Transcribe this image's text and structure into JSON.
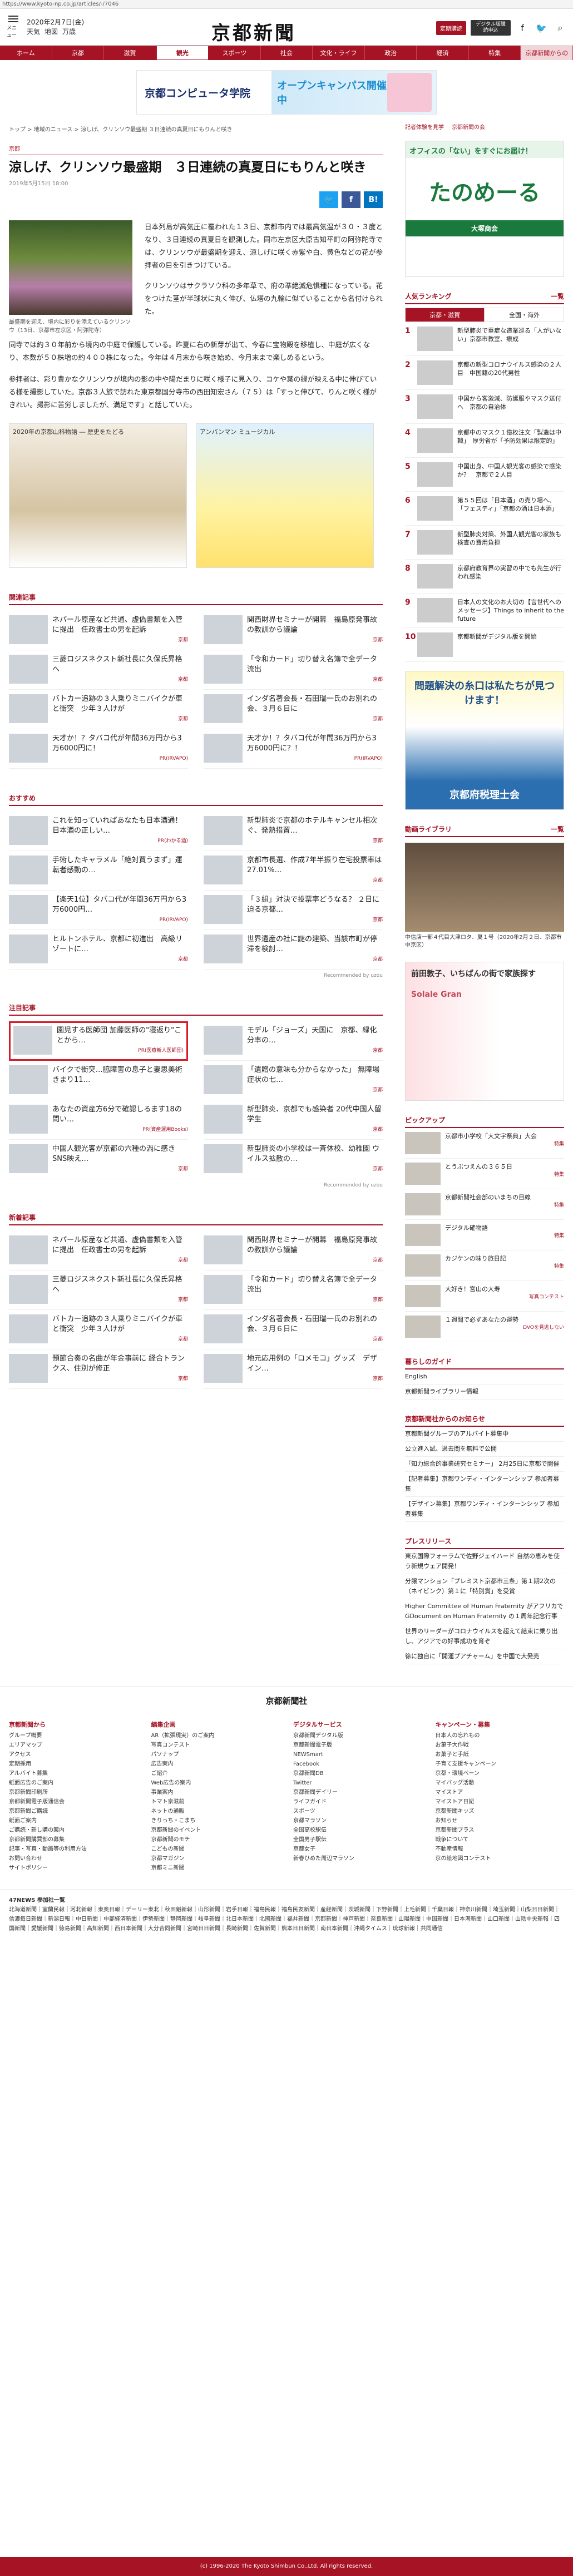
{
  "url": "https://www.kyoto-np.co.jp/articles/-/7046",
  "header": {
    "menu_label": "メニュー",
    "date": "2020年2月7日(金)",
    "links": [
      "天気",
      "地図",
      "万歳"
    ],
    "logo": "京都新聞",
    "btn_red": "定期購読",
    "btn_dark": "デジタル版購読申込",
    "icons": [
      "facebook-icon",
      "twitter-icon",
      "search-icon"
    ]
  },
  "nav": {
    "items": [
      "ホーム",
      "京都",
      "滋賀",
      "観光",
      "スポーツ",
      "社会",
      "文化・ライフ",
      "政治",
      "経済",
      "特集",
      "京都新聞からの"
    ],
    "active_index": 3
  },
  "top_ad": {
    "left": "京都コンピュータ学院",
    "right": "オープンキャンパス開催中"
  },
  "breadcrumb": "トップ > 地域のニュース > 涼しげ、クリンソウ最盛期 ３日連続の真夏日にもりんと咲き",
  "category": "京都",
  "article": {
    "title": "涼しげ、クリンソウ最盛期　３日連続の真夏日にもりんと咲き",
    "date": "2019年5月15日 18:00",
    "share": [
      "Twitter",
      "f",
      "B!"
    ],
    "photo_caption": "最盛期を迎え、境内に彩りを添えているクリンソウ（13日、京都市左京区・阿弥陀寺）",
    "paras_side": [
      "日本列島が高気圧に覆われた１３日、京都市内では最高気温が３０・３度となり、３日連続の真夏日を観測した。同市左京区大原古知平町の阿弥陀寺では、クリンソウが最盛期を迎え、涼しげに咲く赤紫や白、黄色などの花が参拝者の目を引きつけている。",
      "クリンソウはサクラソウ科の多年草で、府の準絶滅危惧種になっている。花をつけた茎が半球状に丸く伸び、仏塔の九輪に似ていることから名付けられた。"
    ],
    "paras_full": [
      "同寺では約３０年前から境内の中庭で保護している。昨夏に右の新芽が出て、今春に宝物殿を移植し、中庭が広くなり、本数が５０株増の約４００株になった。今年は４月末から咲き始め、今月末まで楽しめるという。",
      "参拝者は、彩り豊かなクリンソウが境内の影の中や陽だまりに咲く様子に見入り、コケや葉の緑が映える中に伸びている様を撮影していた。京都３人旅で訪れた東京都国分寺市の西田知宏さん（７５）は「すっと伸びて、りんと咲く様がきれい。撮影に苦労しましたが、満足です」と話していた。"
    ]
  },
  "mid_ads": [
    {
      "label": "2020年の京都山科物語 ― 歴史をたどる"
    },
    {
      "label": "アンパンマン ミュージカル"
    }
  ],
  "related": {
    "heading": "関連記事",
    "items": [
      {
        "text": "ネパール原産など共通、虚偽書類を入管に提出　任政書士の男を起訴",
        "loc": "京都"
      },
      {
        "text": "関西財界セミナーが開幕　福島原発事故の教訓から議論",
        "loc": "京都"
      },
      {
        "text": "三菱ロジスネクスト新社長に久保氏昇格へ",
        "loc": "京都"
      },
      {
        "text": "「令和カード」切り替え名簿で全データ流出",
        "loc": "京都"
      },
      {
        "text": "バトカー追跡の３人乗りミニバイクが車と衝突　少年３人けが",
        "loc": "京都"
      },
      {
        "text": "インダ名著会長・石田瑞一氏のお別れの会、３月６日に",
        "loc": "京都"
      },
      {
        "text": "天才か！？タバコ代が年間36万円から3万6000円に！",
        "loc": "PR(IRVAPO)"
      },
      {
        "text": "天才か！？タバコ代が年間36万円から3万6000円に？！",
        "loc": "PR(IRVAPO)"
      }
    ]
  },
  "osusume": {
    "heading": "おすすめ",
    "items": [
      {
        "text": "これを知っていればあなたも日本酒通！日本酒の正しい…",
        "loc": "PR(わかる酒)"
      },
      {
        "text": "新型肺炎で京都のホテルキャンセル相次ぐ、発熱措置…",
        "loc": "京都"
      },
      {
        "text": "手術したキャラメル「絶対買うまず」運転者感動の…",
        "loc": ""
      },
      {
        "text": "京都市長選、作成7年半振り在宅投票率は27.01%…",
        "loc": "京都"
      },
      {
        "text": "【楽天1位】タバコ代が年間36万円から3万6000円…",
        "loc": "PR(IRVAPO)"
      },
      {
        "text": "「３組」対決で投票率どうなる？ ２日に迫る京都…",
        "loc": "京都"
      },
      {
        "text": "ヒルトンホテル、京都に初進出　高級リゾートに…",
        "loc": "京都"
      },
      {
        "text": "世界遺産の社に謎の建築、当該市町が停滞を検討…",
        "loc": "京都"
      }
    ],
    "recommended": "Recommended by uzou"
  },
  "chumoku": {
    "heading": "注目記事",
    "items": [
      {
        "text": "園児する医師団 加藤医師の\"寝返り\"ことから…",
        "loc": "PR(医療新人医師団)",
        "highlight": true
      },
      {
        "text": "モデル「ジョーズ」天国に　京都、緑化分率の…",
        "loc": "京都"
      },
      {
        "text": "バイクで衝突…脇障害の息子と妻思美術きまり11…",
        "loc": ""
      },
      {
        "text": "「遺贈の意味も分からなかった」 無障場症状の七…",
        "loc": "京都"
      },
      {
        "text": "あなたの資産方6分で確認しるます18の問い…",
        "loc": "PR(資産運用Books)"
      },
      {
        "text": "新型肺炎、京都でも感染者 20代中国人留学生",
        "loc": "京都"
      },
      {
        "text": "中国人観光客が京都の六種の渦に感き SNS映え…",
        "loc": "京都"
      },
      {
        "text": "新型肺炎の小学校は一斉休校、幼稚園 ウイルス拡散の…",
        "loc": "京都"
      }
    ],
    "recommended": "Recommended by uzou"
  },
  "shinchaku": {
    "heading": "新着記事",
    "items": [
      {
        "text": "ネパール原産など共通、虚偽書類を入管に提出　任政書士の男を起訴",
        "loc": "京都"
      },
      {
        "text": "関西財界セミナーが開幕　福島原発事故の教訓から議論",
        "loc": "京都"
      },
      {
        "text": "三菱ロジスネクスト新社長に久保氏昇格へ",
        "loc": "京都"
      },
      {
        "text": "「令和カード」切り替え名簿で全データ流出",
        "loc": "京都"
      },
      {
        "text": "バトカー追跡の３人乗りミニバイクが車と衝突　少年３人けが",
        "loc": "京都"
      },
      {
        "text": "インダ名著会長・石田瑞一氏のお別れの会、３月６日に",
        "loc": "京都"
      },
      {
        "text": "預節合奏の名曲が年金事前に 経合トランクス、住別が修正",
        "loc": "京都"
      },
      {
        "text": "地元応用例の「ロメモコ」グッズ　デザイン…",
        "loc": "京都"
      }
    ]
  },
  "sidebar": {
    "top_links": [
      "記者体験を見学",
      "京都新聞の会"
    ],
    "ad1": {
      "top": "オフィスの「ない」をすぐにお届け！",
      "logo": "たのめーる",
      "bottom": "大塚商会"
    },
    "ranking": {
      "heading": "人気ランキング",
      "more": "一覧",
      "tabs": [
        "京都・滋賀",
        "全国・海外"
      ],
      "items": [
        "新型肺炎で重症な造業巡る「人がいない」京都市教室、療成",
        "京都の新型コロナウイルス感染の２人目　中国籍の20代男性",
        "中国から客激減、防護服やマスク送付へ　京都の自治体",
        "京都中のマスク１億枚注文「製造は中韓」　厚労省が「予防効果は限定的」",
        "中国出身、中国人観光客の感染で感染か？　京都で２人目",
        "第５５回は「日本酒」の売り場へ、「フェスティ」「京都の酒は日本酒」",
        "新型肺炎対策、外国人観光客の家族も検査の費用負担",
        "京都府教育界の実習の中でも先生が行われ感染",
        "日本人の文化のお大切の【言世代へのメッセージ】Things to inherit to the future",
        "京都新聞がデジタル版を開始"
      ]
    },
    "ad2": {
      "text": "問題解決の糸口は私たちが見つけます！",
      "bottom": "京都府税理士会"
    },
    "video": {
      "heading": "動画ライブラリ",
      "more": "一覧",
      "caption": "中信店一部４代目大津ロタ、夏１号（2020年2月２日、京都市中京区）"
    },
    "ad3": {
      "text": "前田敦子、いちばんの街で家族探す",
      "brand": "Solale Gran"
    },
    "pickup": {
      "heading": "ピックアップ",
      "items": [
        {
          "text": "京都市小学校「大文字祭典」大会",
          "loc": "特集"
        },
        {
          "text": "とうぶつえんの３６５日",
          "loc": "特集"
        },
        {
          "text": "京都新聞社会部のいまちの目線",
          "loc": "特集"
        },
        {
          "text": "デジタル確物語",
          "loc": "特集"
        },
        {
          "text": "カジケンの味り旅日記",
          "loc": "特集"
        },
        {
          "text": "大好き！宮山の大寿",
          "loc": "写真コンテスト"
        },
        {
          "text": "１週間で必ずあなたの運勢",
          "loc": "DVOを見逃しない"
        }
      ]
    },
    "guide": {
      "heading": "暮らしのガイド",
      "items": [
        "English",
        "京都新聞ライブラリー情報"
      ]
    },
    "notice": {
      "heading": "京都新聞社からのお知らせ",
      "items": [
        "京都新聞グループのアルバイト募集中",
        "公立進入試、過去問を無料で公開",
        "「知力総合的事業研究セミナー」 2月25日に京都で開催",
        "【記者募集】京都ワンディ・インターンシップ 参加者募集",
        "【デザイン募集】京都ワンディ・インターンシップ 参加者募集"
      ]
    },
    "press": {
      "heading": "プレスリリース",
      "items": [
        "東京国際フォーラムで佐野ジェイハード 自然の恵みを使う新規ウェア開発！",
        "分譲マンション「プレミスト京都市三条」第１期2次の（ネイビンク）第１に「特別賞」を受賞",
        "Higher Committee of Human Fraternity がアフリカでGDocument on Human Fraternity の１周年記念行事",
        "世界のリーダーがコロナウイルスを超えて結束に乗り出し、アジアでの好事成功を育ぞ",
        "徐に独自に「開運プアチャーム」を中国で大発売"
      ]
    }
  },
  "footer": {
    "logo": "京都新聞社",
    "cols": [
      {
        "title": "京都新聞から",
        "links": [
          "グループ概要",
          "エリアマップ",
          "アクセス",
          "定期採用",
          "アルバイト募集",
          "紙面広告のご案内",
          "京都新聞印刷所",
          "京都新聞電子版通信会",
          "京都新聞ご購読",
          "紙面ご案内",
          "ご購読・新し購の案内",
          "京都新聞購買部の募集",
          "記事・写真・動画等の利用方法",
          "お問い合わせ",
          "サイトポリシー"
        ]
      },
      {
        "title": "編集企画",
        "links": [
          "AR（拡張現実）のご案内",
          "写真コンテスト",
          "パソナップ",
          "広告案内",
          "ご紹介",
          "Web広告の案内",
          "事業案内",
          "トマト京滋前",
          "ネットの通販",
          "きりっち・こまち",
          "京都新聞のイベント",
          "京都新聞のモチ",
          "こどもの新聞",
          "京都マガジン",
          "京都ミニ新聞"
        ]
      },
      {
        "title": "デジタルサービス",
        "links": [
          "京都新聞デジタル版",
          "京都新聞電子版",
          "NEWSmart",
          "Facebook",
          "京都新聞DB",
          "Twitter",
          "京都新聞デイリー",
          "ライフガイド",
          "スポーツ",
          "京都マラソン",
          "全国高校駅伝",
          "全国男子駅伝",
          "京都女子",
          "新春ひめた周辺マラソン"
        ]
      },
      {
        "title": "キャンペーン・募集",
        "links": [
          "日本人の忘れもの",
          "お菓子大作戦",
          "お菓子と手紙",
          "子育て支援キャンペーン",
          "京都・環境ペーン",
          "マイバッグ活動",
          "マイストア",
          "マイストア日記",
          "京都新聞キッズ",
          "お知らせ",
          "京都新聞プラス",
          "戦争について",
          "不動産情報",
          "京の絵地図コンテスト"
        ]
      }
    ]
  },
  "fourty": {
    "title": "47NEWS 参加社一覧",
    "text": "北海道新聞｜室蘭民報｜河北新報｜東奥日報｜デーリー東北｜秋田魁新報｜山形新聞｜岩手日報｜福島民報｜福島民友新聞｜産経新聞｜茨城新聞｜下野新聞｜上毛新聞｜千葉日報｜神奈川新聞｜埼玉新聞｜山梨日日新聞｜信濃毎日新聞｜新潟日報｜中日新聞｜中部経済新聞｜伊勢新聞｜静岡新聞｜岐阜新聞｜北日本新聞｜北國新聞｜福井新聞｜京都新聞｜神戸新聞｜奈良新聞｜山陽新聞｜中国新聞｜日本海新聞｜山口新聞｜山陰中央新報｜四国新聞｜愛媛新聞｜徳島新聞｜高知新聞｜西日本新聞｜大分合同新聞｜宮崎日日新聞｜長崎新聞｜佐賀新聞｜熊本日日新聞｜南日本新聞｜沖縄タイムス｜琉球新報｜共同通信"
  },
  "copyright": "(c) 1996-2020 The Kyoto Shimbun Co.,Ltd. All rights reserved.",
  "colors": {
    "brand": "#a51324",
    "highlight_border": "#d81b28"
  }
}
